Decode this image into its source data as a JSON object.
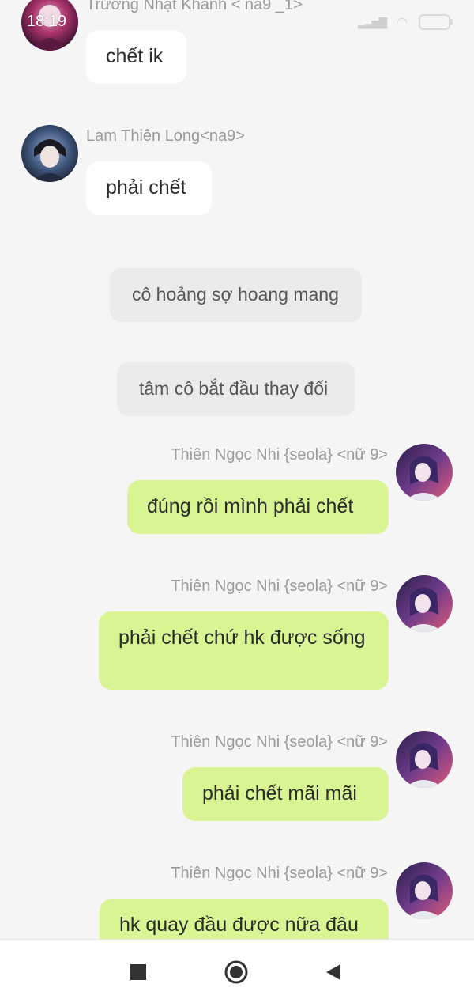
{
  "status": {
    "time": "18:19"
  },
  "messages": [
    {
      "sender": "Trương Nhật Khanh < na9 _1>",
      "text": "chết ik"
    },
    {
      "sender": "Lam Thiên Long<na9>",
      "text": "phải chết"
    },
    {
      "narration": "cô hoảng sợ hoang mang"
    },
    {
      "narration": "tâm cô bắt đầu thay đổi"
    },
    {
      "sender": "Thiên Ngọc Nhi {seola} <nữ 9>",
      "text": "đúng rồi mình phải chết"
    },
    {
      "sender": "Thiên Ngọc Nhi {seola} <nữ 9>",
      "text": "phải chết chứ hk được sống"
    },
    {
      "sender": "Thiên Ngọc Nhi {seola} <nữ 9>",
      "text": "phải chết mãi mãi"
    },
    {
      "sender": "Thiên Ngọc Nhi {seola} <nữ 9>",
      "text": "hk quay đầu được nữa đâu"
    }
  ],
  "navbar": {
    "icons": [
      "square-recent-icon",
      "circle-home-icon",
      "triangle-back-icon"
    ]
  },
  "colors": {
    "background": "#f5f5f5",
    "incoming_bubble": "#ffffff",
    "outgoing_bubble": "#d8f493",
    "narration_bubble": "#ebebeb",
    "name_text": "#9a9a9a"
  }
}
